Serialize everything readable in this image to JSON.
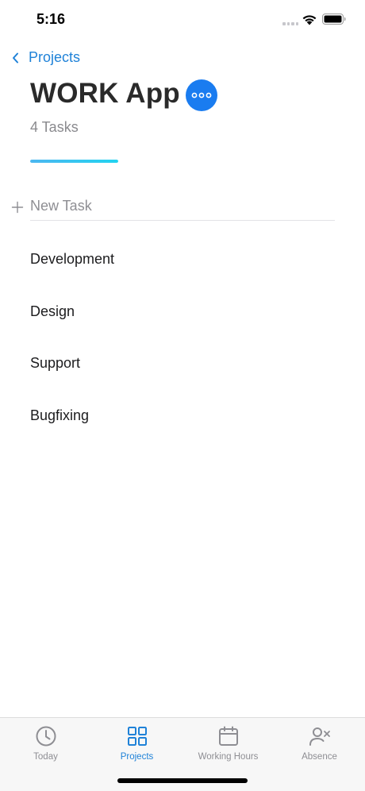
{
  "status_bar": {
    "time": "5:16"
  },
  "nav": {
    "back_label": "Projects"
  },
  "project": {
    "title": "WORK App",
    "task_count": "4 Tasks",
    "progress_fraction": 1.0,
    "accent_color": "#1a7cf0"
  },
  "new_task": {
    "placeholder": "New Task"
  },
  "tasks": [
    {
      "label": "Development"
    },
    {
      "label": "Design"
    },
    {
      "label": "Support"
    },
    {
      "label": "Bugfixing"
    }
  ],
  "tab_bar": {
    "active_color": "#1f82d8",
    "inactive_color": "#8e8e93",
    "tabs": [
      {
        "label": "Today",
        "icon": "clock-icon",
        "active": false
      },
      {
        "label": "Projects",
        "icon": "grid-icon",
        "active": true
      },
      {
        "label": "Working Hours",
        "icon": "calendar-icon",
        "active": false
      },
      {
        "label": "Absence",
        "icon": "person-x-icon",
        "active": false
      }
    ]
  }
}
